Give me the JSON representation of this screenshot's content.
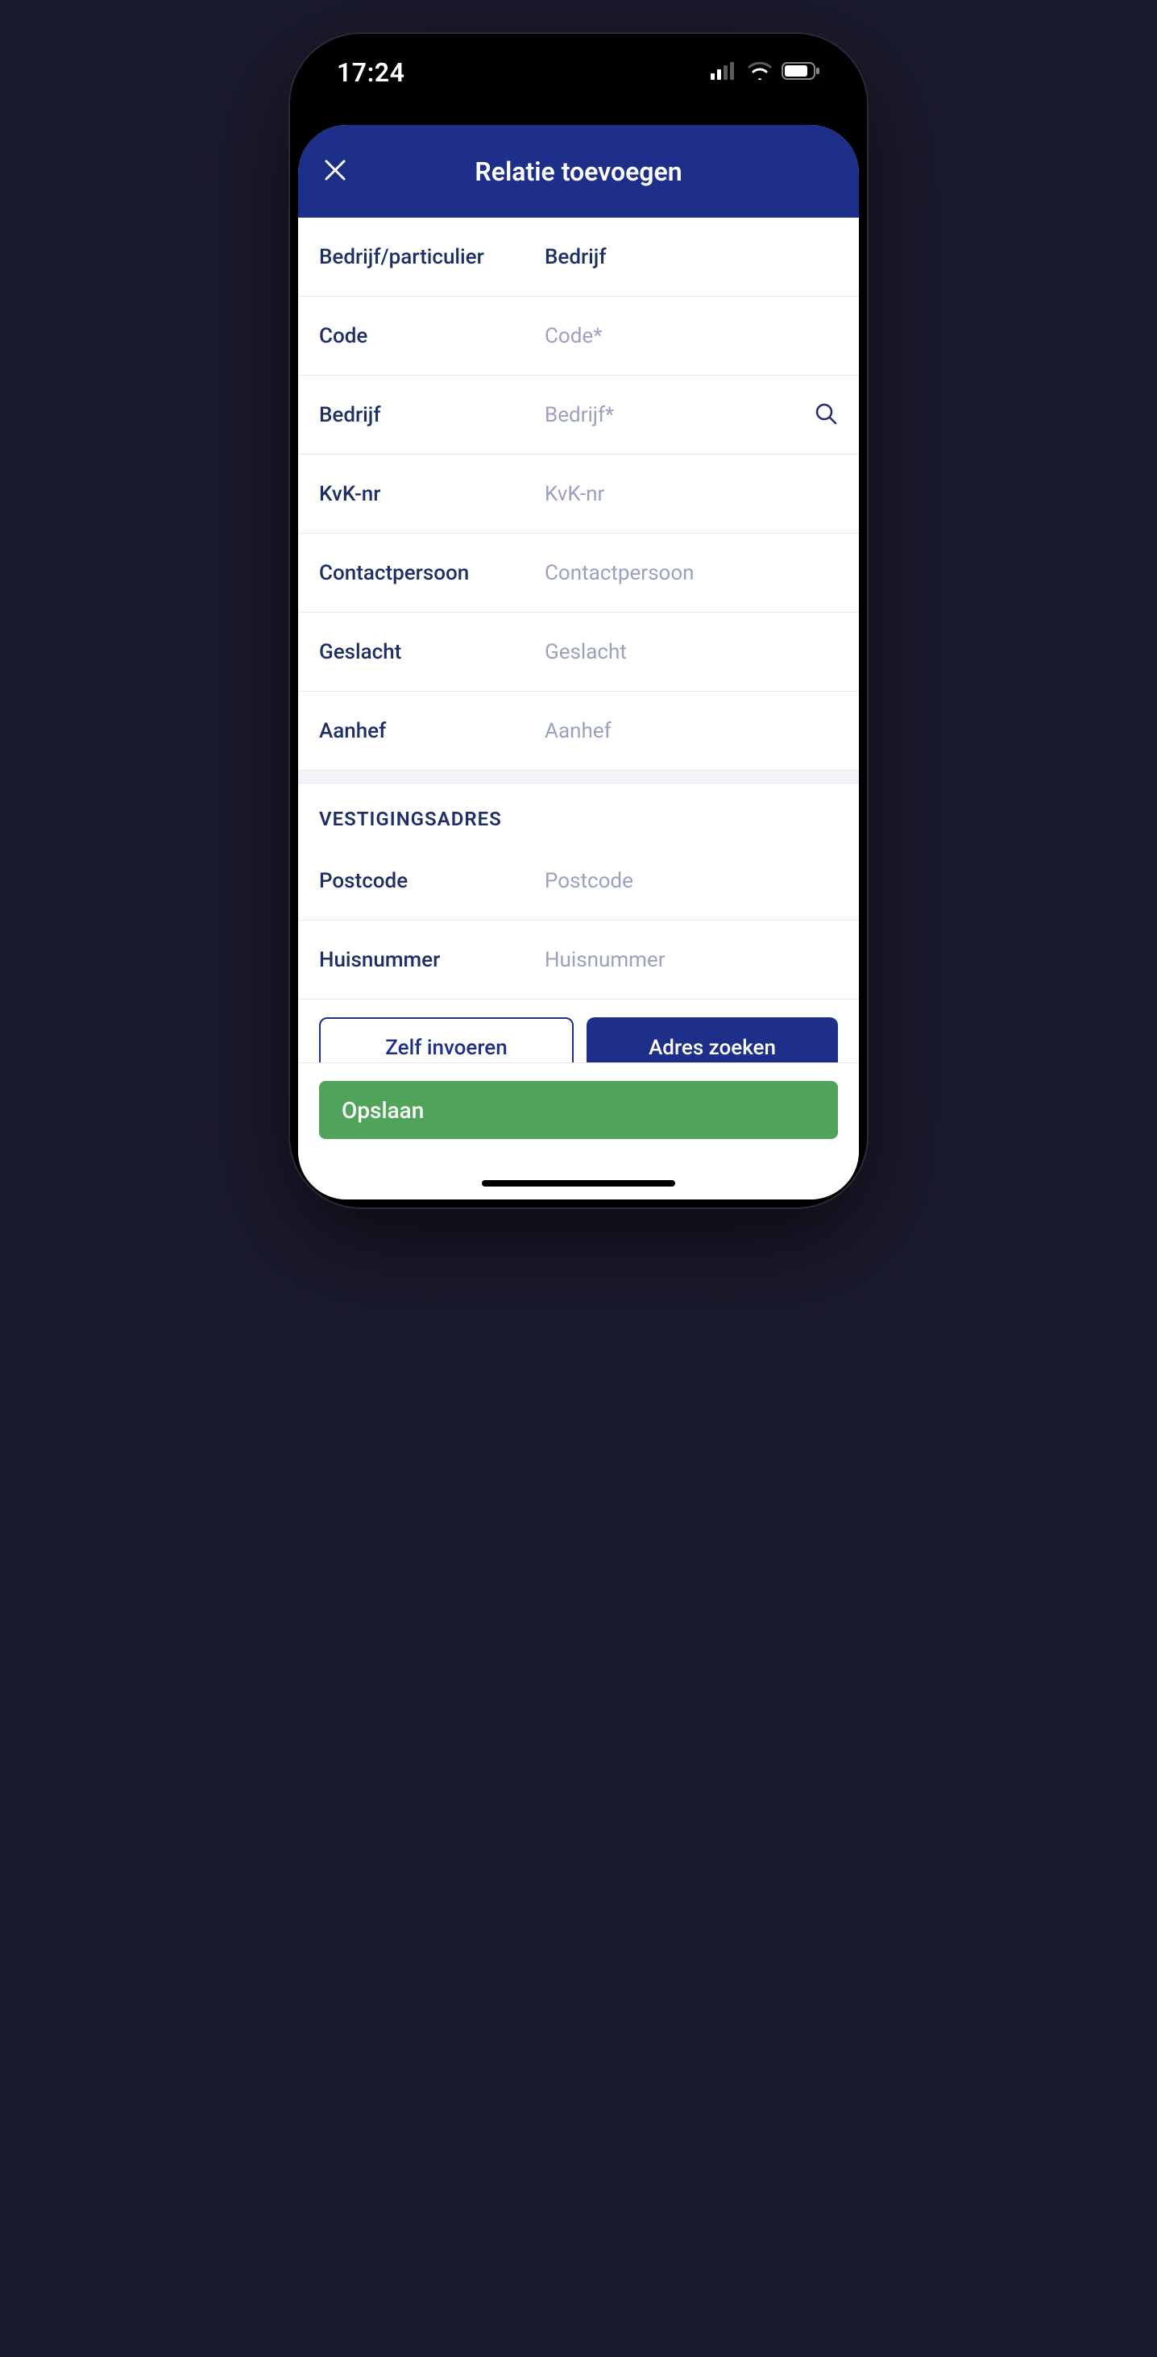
{
  "status": {
    "time": "17:24"
  },
  "header": {
    "title": "Relatie toevoegen"
  },
  "fields": {
    "type": {
      "label": "Bedrijf/particulier",
      "value": "Bedrijf"
    },
    "code": {
      "label": "Code",
      "placeholder": "Code*"
    },
    "company": {
      "label": "Bedrijf",
      "placeholder": "Bedrijf*"
    },
    "kvk": {
      "label": "KvK-nr",
      "placeholder": "KvK-nr"
    },
    "contact": {
      "label": "Contactpersoon",
      "placeholder": "Contactpersoon"
    },
    "gender": {
      "label": "Geslacht",
      "placeholder": "Geslacht"
    },
    "salutation": {
      "label": "Aanhef",
      "placeholder": "Aanhef"
    }
  },
  "address": {
    "section_title": "VESTIGINGSADRES",
    "postcode": {
      "label": "Postcode",
      "placeholder": "Postcode"
    },
    "housenumber": {
      "label": "Huisnummer",
      "placeholder": "Huisnummer"
    }
  },
  "buttons": {
    "manual": "Zelf invoeren",
    "lookup": "Adres zoeken",
    "save": "Opslaan"
  },
  "colors": {
    "primary": "#1d2f88",
    "text": "#1d2f66",
    "muted": "#9ba0c0",
    "success": "#4fa35a"
  }
}
